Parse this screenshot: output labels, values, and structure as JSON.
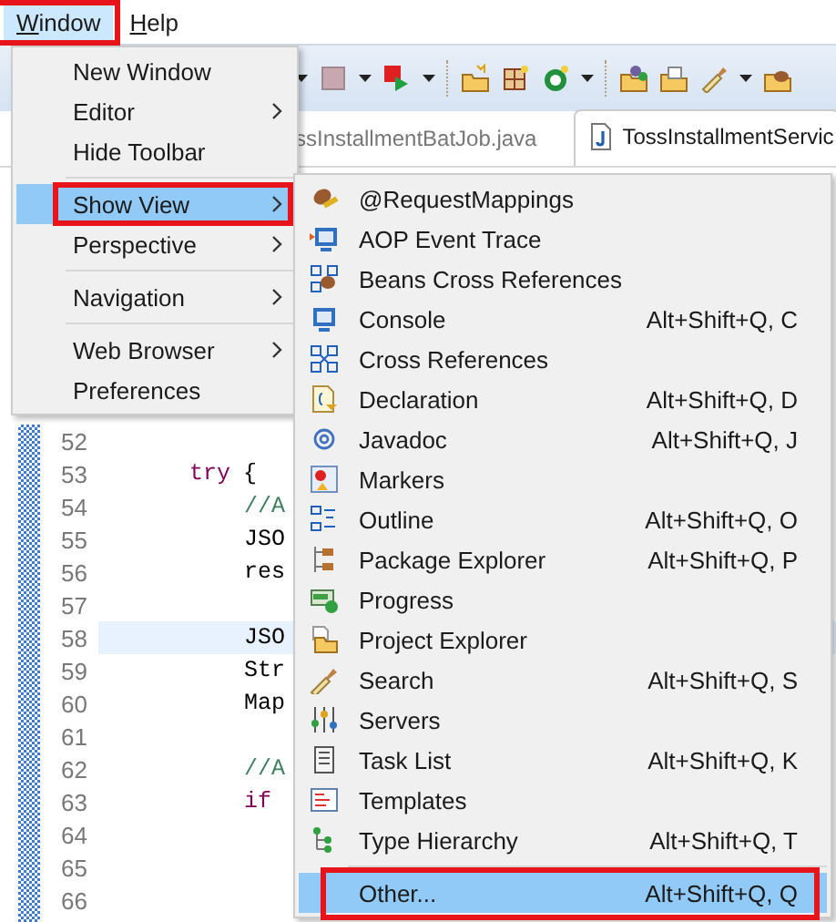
{
  "menubar": [
    {
      "label": "Window",
      "selected": true,
      "highlighted": true
    },
    {
      "label": "Help",
      "selected": false,
      "highlighted": false
    }
  ],
  "editor_tabs": [
    {
      "label": "ssInstallmentBatJob.java",
      "selected": false
    },
    {
      "label": "TossInstallmentServic",
      "selected": true
    }
  ],
  "editor": {
    "lines": [
      {
        "number": "52",
        "current": false
      },
      {
        "number": "53",
        "current": false,
        "tokens": [
          {
            "text": "try",
            "kind": "keyword"
          },
          {
            "text": "{",
            "kind": "plain"
          }
        ],
        "children": [
          {
            "number": "54",
            "current": false,
            "tokens": [
              {
                "text": "//A",
                "kind": "comment"
              }
            ]
          },
          {
            "number": "55",
            "current": false,
            "tokens": [
              {
                "text": "JSO",
                "kind": "plain"
              }
            ]
          },
          {
            "number": "56",
            "current": false,
            "tokens": [
              {
                "text": "res",
                "kind": "plain"
              }
            ]
          },
          {
            "number": "57",
            "current": false
          },
          {
            "number": "58",
            "current": true,
            "tokens": [
              {
                "text": "JSO",
                "kind": "plain"
              }
            ]
          },
          {
            "number": "59",
            "current": false,
            "tokens": [
              {
                "text": "Str",
                "kind": "plain"
              }
            ]
          },
          {
            "number": "60",
            "current": false,
            "tokens": [
              {
                "text": "Map",
                "kind": "plain"
              }
            ]
          },
          {
            "number": "61",
            "current": false
          },
          {
            "number": "62",
            "current": false,
            "tokens": [
              {
                "text": "//A",
                "kind": "comment"
              }
            ]
          },
          {
            "number": "63",
            "current": false,
            "tokens": [
              {
                "text": "if",
                "kind": "keyword"
              }
            ]
          },
          {
            "number": "64",
            "current": false
          },
          {
            "number": "65",
            "current": false
          },
          {
            "number": "66",
            "current": false
          }
        ]
      }
    ]
  },
  "window_menu": {
    "groups": [
      [
        {
          "label": "New Window",
          "submenu": false,
          "selected": false,
          "highlighted": false
        },
        {
          "label": "Editor",
          "submenu": true,
          "selected": false,
          "highlighted": false
        },
        {
          "label": "Hide Toolbar",
          "submenu": false,
          "selected": false,
          "highlighted": false
        }
      ],
      [
        {
          "label": "Show View",
          "submenu": true,
          "selected": true,
          "highlighted": true
        },
        {
          "label": "Perspective",
          "submenu": true,
          "selected": false,
          "highlighted": false
        }
      ],
      [
        {
          "label": "Navigation",
          "submenu": true,
          "selected": false,
          "highlighted": false
        }
      ],
      [
        {
          "label": "Web Browser",
          "submenu": true,
          "selected": false,
          "highlighted": false
        },
        {
          "label": "Preferences",
          "submenu": false,
          "selected": false,
          "highlighted": false
        }
      ]
    ]
  },
  "show_view_menu": {
    "groups": [
      [
        {
          "label": "@RequestMappings",
          "selected": false,
          "highlighted": false
        },
        {
          "label": "AOP Event Trace",
          "selected": false,
          "highlighted": false
        },
        {
          "label": "Beans Cross References",
          "selected": false,
          "highlighted": false
        },
        {
          "label": "Console",
          "shortcut": "Alt+Shift+Q, C",
          "selected": false,
          "highlighted": false
        },
        {
          "label": "Cross References",
          "selected": false,
          "highlighted": false
        },
        {
          "label": "Declaration",
          "shortcut": "Alt+Shift+Q, D",
          "selected": false,
          "highlighted": false
        },
        {
          "label": "Javadoc",
          "shortcut": "Alt+Shift+Q, J",
          "selected": false,
          "highlighted": false
        },
        {
          "label": "Markers",
          "selected": false,
          "highlighted": false
        },
        {
          "label": "Outline",
          "shortcut": "Alt+Shift+Q, O",
          "selected": false,
          "highlighted": false
        },
        {
          "label": "Package Explorer",
          "shortcut": "Alt+Shift+Q, P",
          "selected": false,
          "highlighted": false
        },
        {
          "label": "Progress",
          "selected": false,
          "highlighted": false
        },
        {
          "label": "Project Explorer",
          "selected": false,
          "highlighted": false
        },
        {
          "label": "Search",
          "shortcut": "Alt+Shift+Q, S",
          "selected": false,
          "highlighted": false
        },
        {
          "label": "Servers",
          "selected": false,
          "highlighted": false
        },
        {
          "label": "Task List",
          "shortcut": "Alt+Shift+Q, K",
          "selected": false,
          "highlighted": false
        },
        {
          "label": "Templates",
          "selected": false,
          "highlighted": false
        },
        {
          "label": "Type Hierarchy",
          "shortcut": "Alt+Shift+Q, T",
          "selected": false,
          "highlighted": false
        }
      ],
      [
        {
          "label": "Other...",
          "shortcut": "Alt+Shift+Q, Q",
          "selected": true,
          "highlighted": true
        }
      ]
    ]
  }
}
